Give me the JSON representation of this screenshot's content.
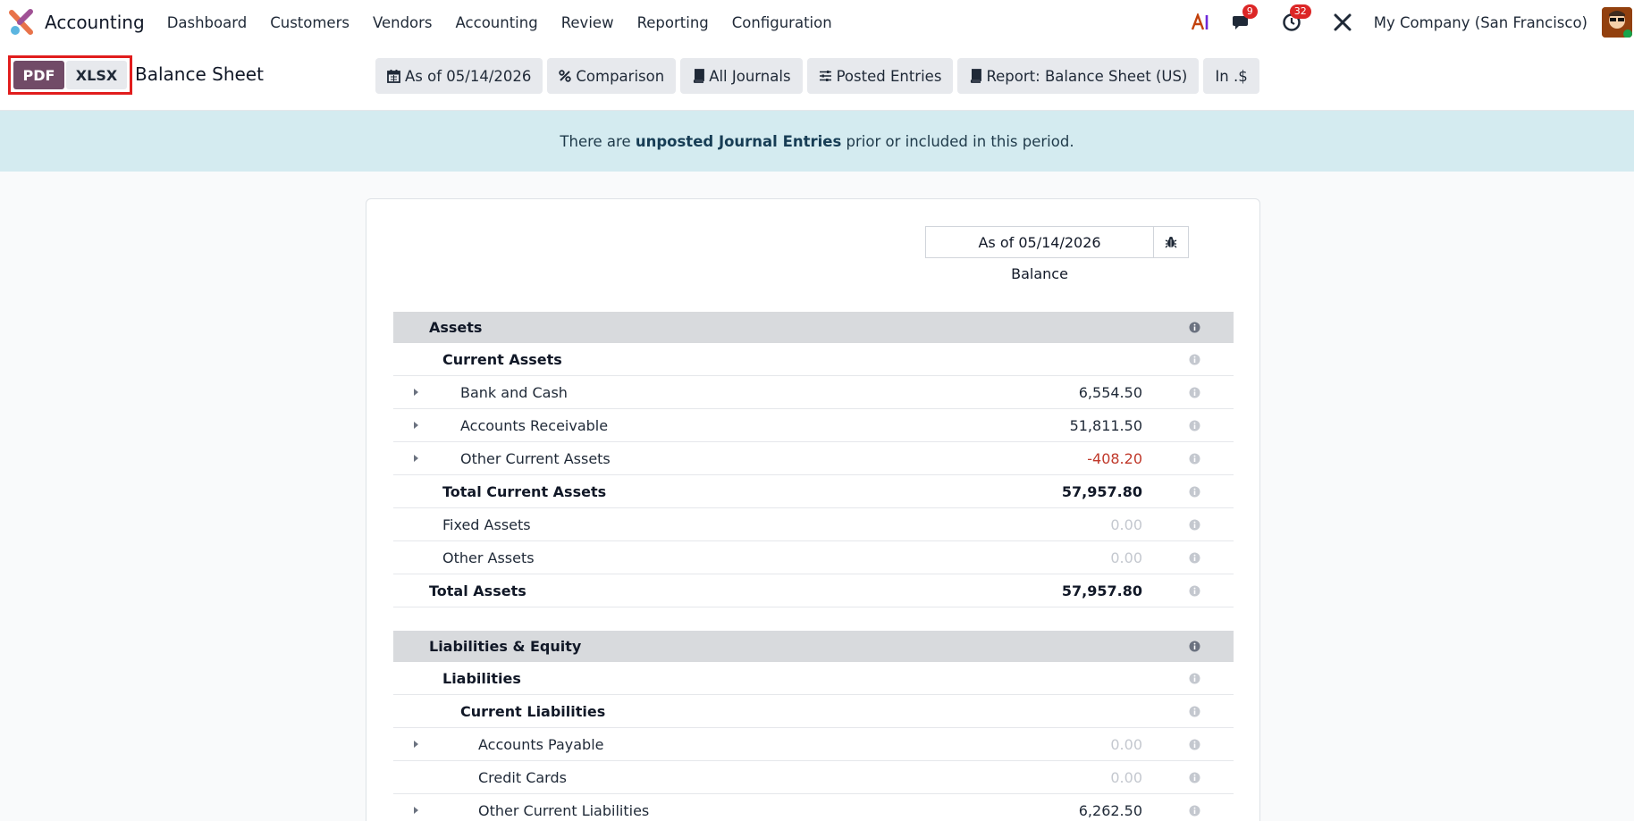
{
  "app": {
    "name": "Accounting"
  },
  "nav": {
    "items": [
      "Dashboard",
      "Customers",
      "Vendors",
      "Accounting",
      "Review",
      "Reporting",
      "Configuration"
    ],
    "messages_count": "9",
    "activities_count": "32",
    "company": "My Company (San Francisco)"
  },
  "control_panel": {
    "pdf_label": "PDF",
    "xlsx_label": "XLSX",
    "title": "Balance Sheet",
    "filters": {
      "date": "As of 05/14/2026",
      "comparison": "Comparison",
      "journals": "All Journals",
      "entries": "Posted Entries",
      "report": "Report: Balance Sheet (US)",
      "currency": "In .$"
    }
  },
  "alert": {
    "prefix": "There are ",
    "link": "unposted Journal Entries",
    "suffix": " prior or included in this period."
  },
  "report": {
    "column_date": "As of 05/14/2026",
    "column_label": "Balance",
    "rows": [
      {
        "label": "Assets",
        "value": ""
      },
      {
        "label": "Current Assets",
        "value": ""
      },
      {
        "label": "Bank and Cash",
        "value": "6,554.50"
      },
      {
        "label": "Accounts Receivable",
        "value": "51,811.50"
      },
      {
        "label": "Other Current Assets",
        "value": "-408.20"
      },
      {
        "label": "Total Current Assets",
        "value": "57,957.80"
      },
      {
        "label": "Fixed Assets",
        "value": "0.00"
      },
      {
        "label": "Other Assets",
        "value": "0.00"
      },
      {
        "label": "Total Assets",
        "value": "57,957.80"
      },
      {
        "label": "Liabilities & Equity",
        "value": ""
      },
      {
        "label": "Liabilities",
        "value": ""
      },
      {
        "label": "Current Liabilities",
        "value": ""
      },
      {
        "label": "Accounts Payable",
        "value": "0.00"
      },
      {
        "label": "Credit Cards",
        "value": "0.00"
      },
      {
        "label": "Other Current Liabilities",
        "value": "6,262.50"
      }
    ]
  },
  "colors": {
    "brand": "#714b67",
    "alert_bg": "#d4ebf0",
    "negative": "#c0392b",
    "highlight": "#e11d1d"
  }
}
